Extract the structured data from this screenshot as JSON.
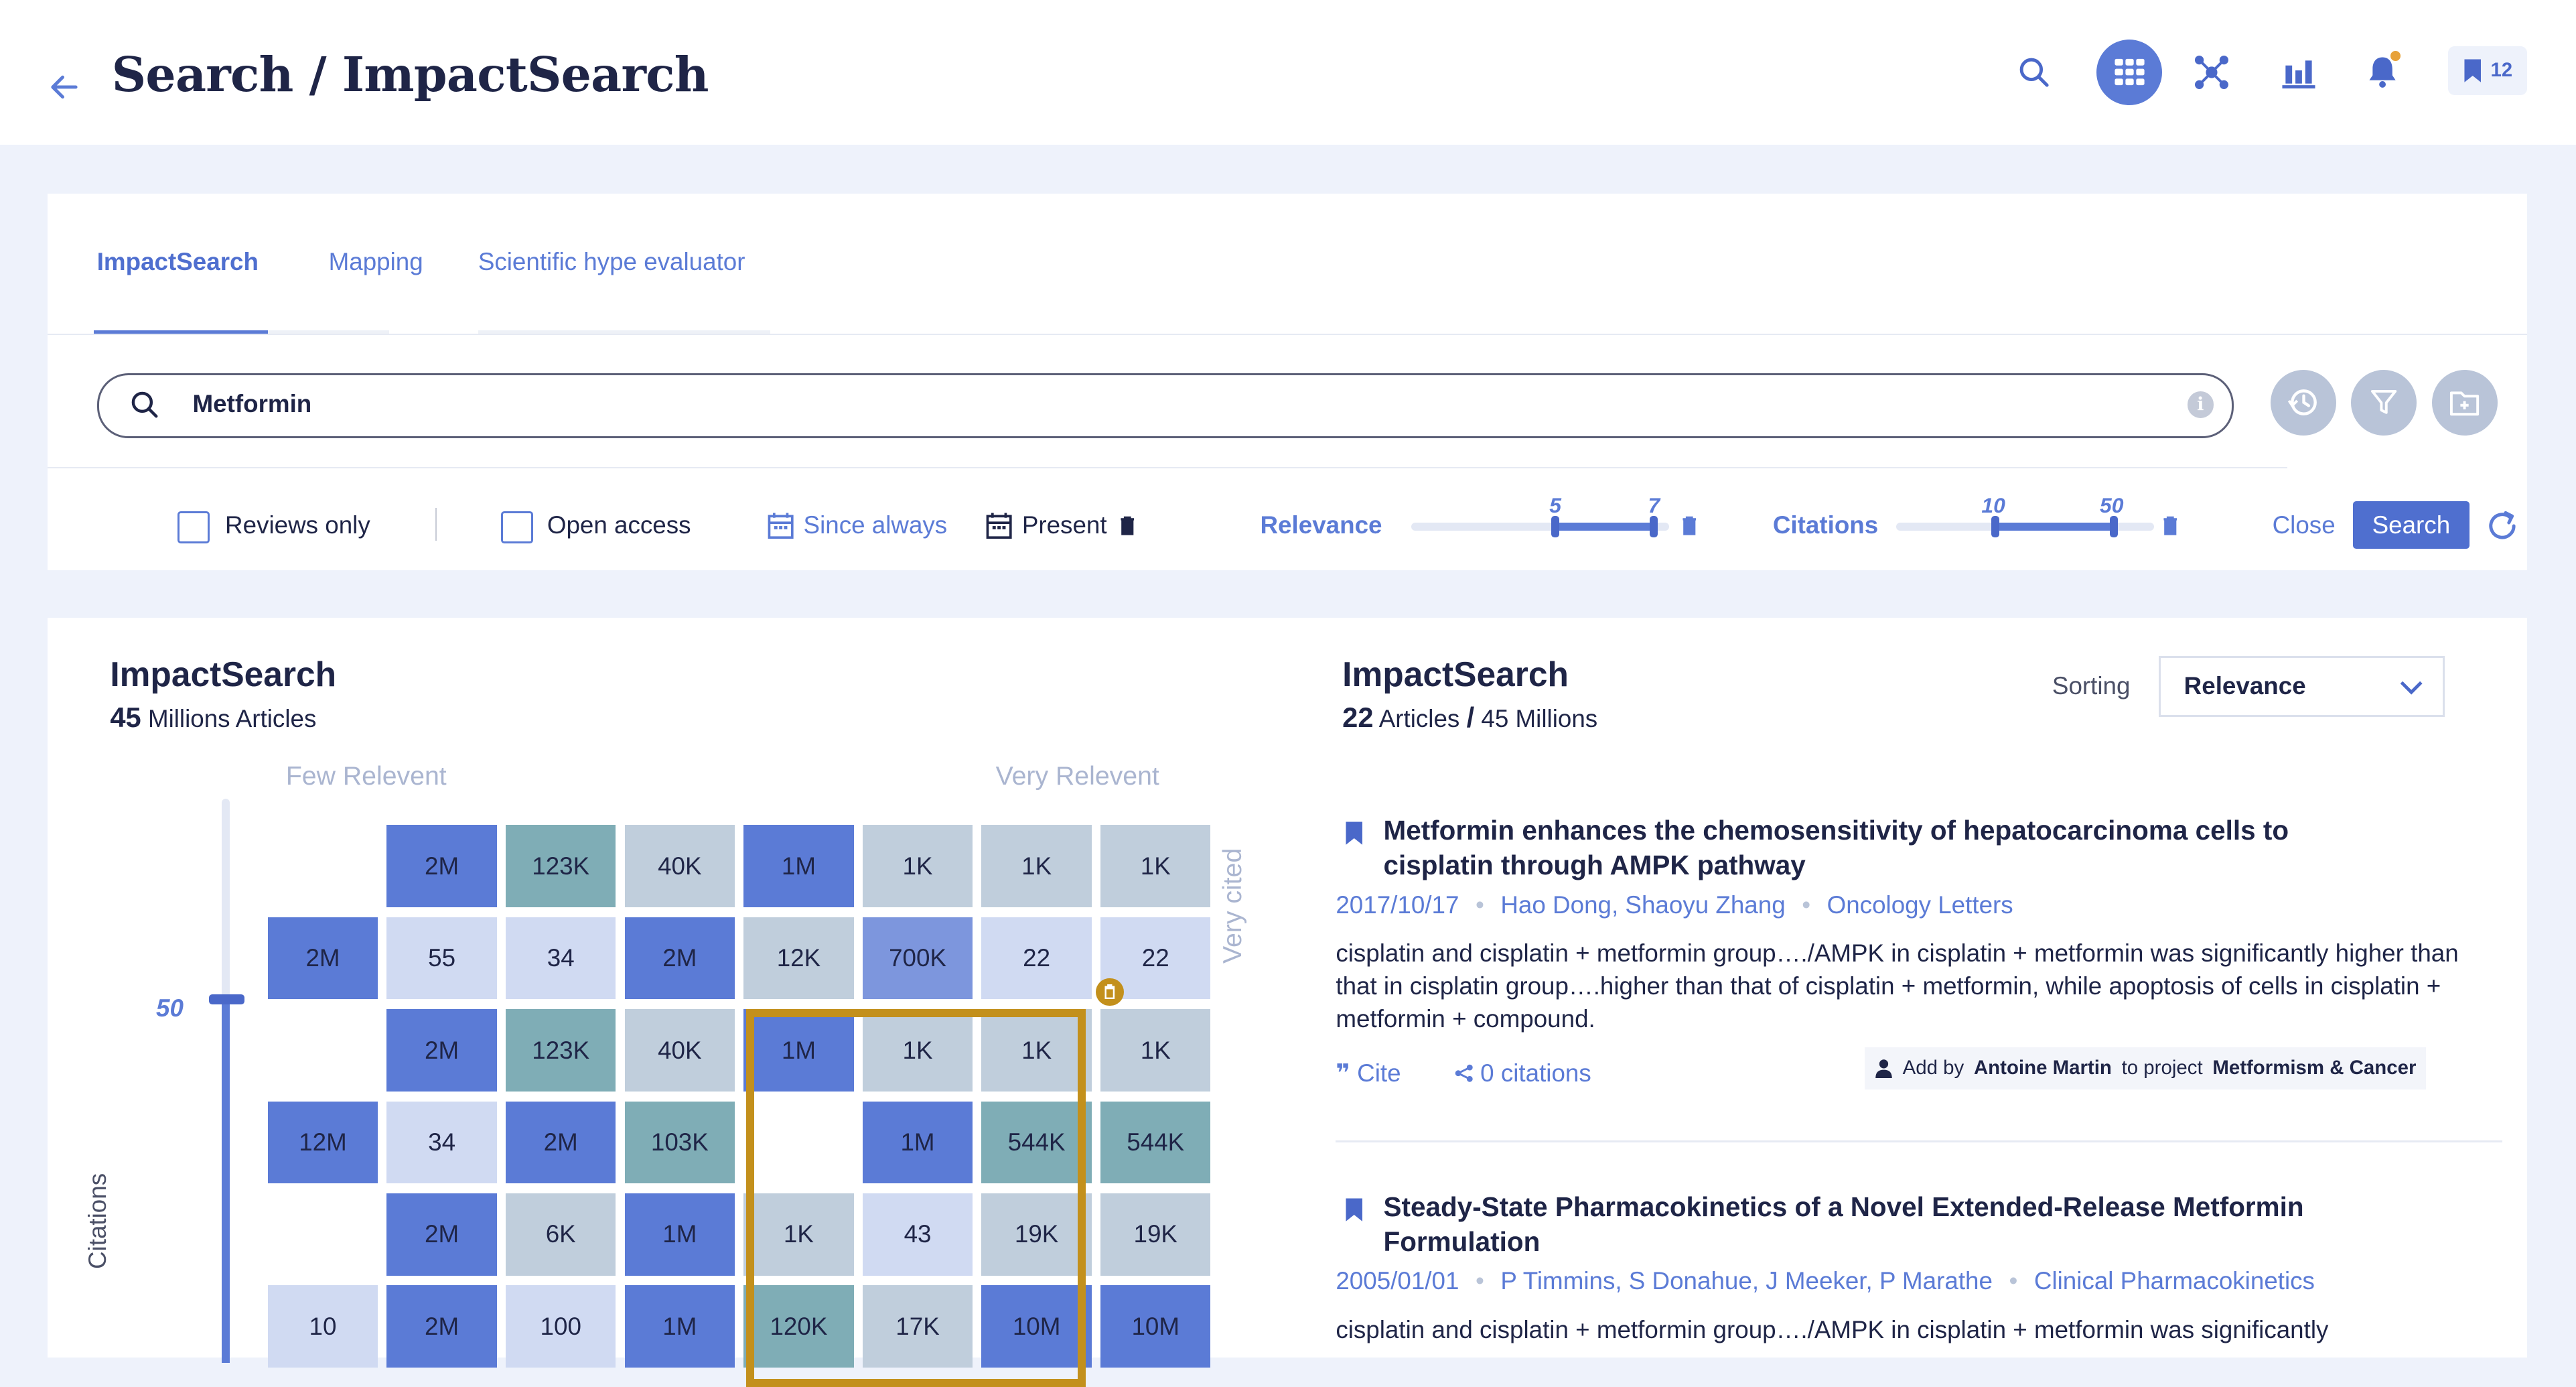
{
  "header": {
    "title": "Search / ImpactSearch",
    "bookmark_count": "12",
    "icons": [
      "back-arrow-icon",
      "search-icon",
      "grid-icon",
      "network-icon",
      "bar-chart-icon",
      "bell-icon",
      "bookmark-icon"
    ]
  },
  "tabs": [
    {
      "label": "ImpactSearch",
      "active": true
    },
    {
      "label": "Mapping",
      "active": false
    },
    {
      "label": "Scientific hype evaluator",
      "active": false
    }
  ],
  "search": {
    "query": "Metformin"
  },
  "filters": {
    "reviews_only": "Reviews only",
    "open_access": "Open access",
    "since_label": "Since always",
    "present_label": "Present",
    "relevance_label": "Relevance",
    "relevance_min": "5",
    "relevance_max": "7",
    "citations_label": "Citations",
    "citations_min": "10",
    "citations_max": "50",
    "close_label": "Close",
    "search_label": "Search"
  },
  "impact": {
    "title": "ImpactSearch",
    "count": "45",
    "count_unit": "Millions Articles",
    "few_relevant": "Few Relevent",
    "very_relevant": "Very Relevent",
    "very_cited": "Very cited",
    "citations_axis": "Citations",
    "citations_marker": "50"
  },
  "grid": [
    [
      "",
      "2M",
      "123K",
      "40K",
      "1M",
      "1K",
      "1K",
      "1K"
    ],
    [
      "2M",
      "55",
      "34",
      "2M",
      "12K",
      "700K",
      "22",
      "22"
    ],
    [
      "",
      "2M",
      "123K",
      "40K",
      "1M",
      "1K",
      "1K",
      "1K"
    ],
    [
      "12M",
      "34",
      "2M",
      "103K",
      "",
      "1M",
      "544K",
      "544K"
    ],
    [
      "",
      "2M",
      "6K",
      "1M",
      "1K",
      "43",
      "19K",
      "19K"
    ],
    [
      "10",
      "2M",
      "100",
      "1M",
      "120K",
      "17K",
      "10M",
      "10M"
    ]
  ],
  "grid_colors": {
    "strong_blue": "#5b7bd6",
    "medium_blue": "#7d96dd",
    "light_blue": "#d0daf2",
    "teal": "#7fadb6",
    "grey": "#c0cedc"
  },
  "results": {
    "title": "ImpactSearch",
    "count": "22",
    "count_unit": "Articles",
    "total": "45",
    "total_unit": "Millions",
    "sorting_label": "Sorting",
    "sorting_value": "Relevance",
    "articles": [
      {
        "title": "Metformin enhances the chemosensitivity of hepatocarcinoma cells to cisplatin through AMPK pathway",
        "date": "2017/10/17",
        "authors": "Hao Dong, Shaoyu Zhang",
        "journal": "Oncology Letters",
        "abstract": "cisplatin and cisplatin + metformin group…./AMPK in cisplatin + metformin was significantly higher than that in cisplatin group….higher than that of cisplatin + metformin, while apoptosis of cells in cisplatin + metformin + compound.",
        "cite": "Cite",
        "citations": "0 citations",
        "added_prefix": "Add by",
        "added_by": "Antoine Martin",
        "added_mid": "to project",
        "project": "Metformism & Cancer"
      },
      {
        "title": "Steady-State Pharmacokinetics of a Novel Extended-Release Metformin Formulation",
        "date": "2005/01/01",
        "authors": "P Timmins, S Donahue, J Meeker, P Marathe",
        "journal": "Clinical Pharmacokinetics",
        "abstract": "cisplatin and cisplatin + metformin group…./AMPK in cisplatin + metformin was significantly"
      }
    ]
  }
}
